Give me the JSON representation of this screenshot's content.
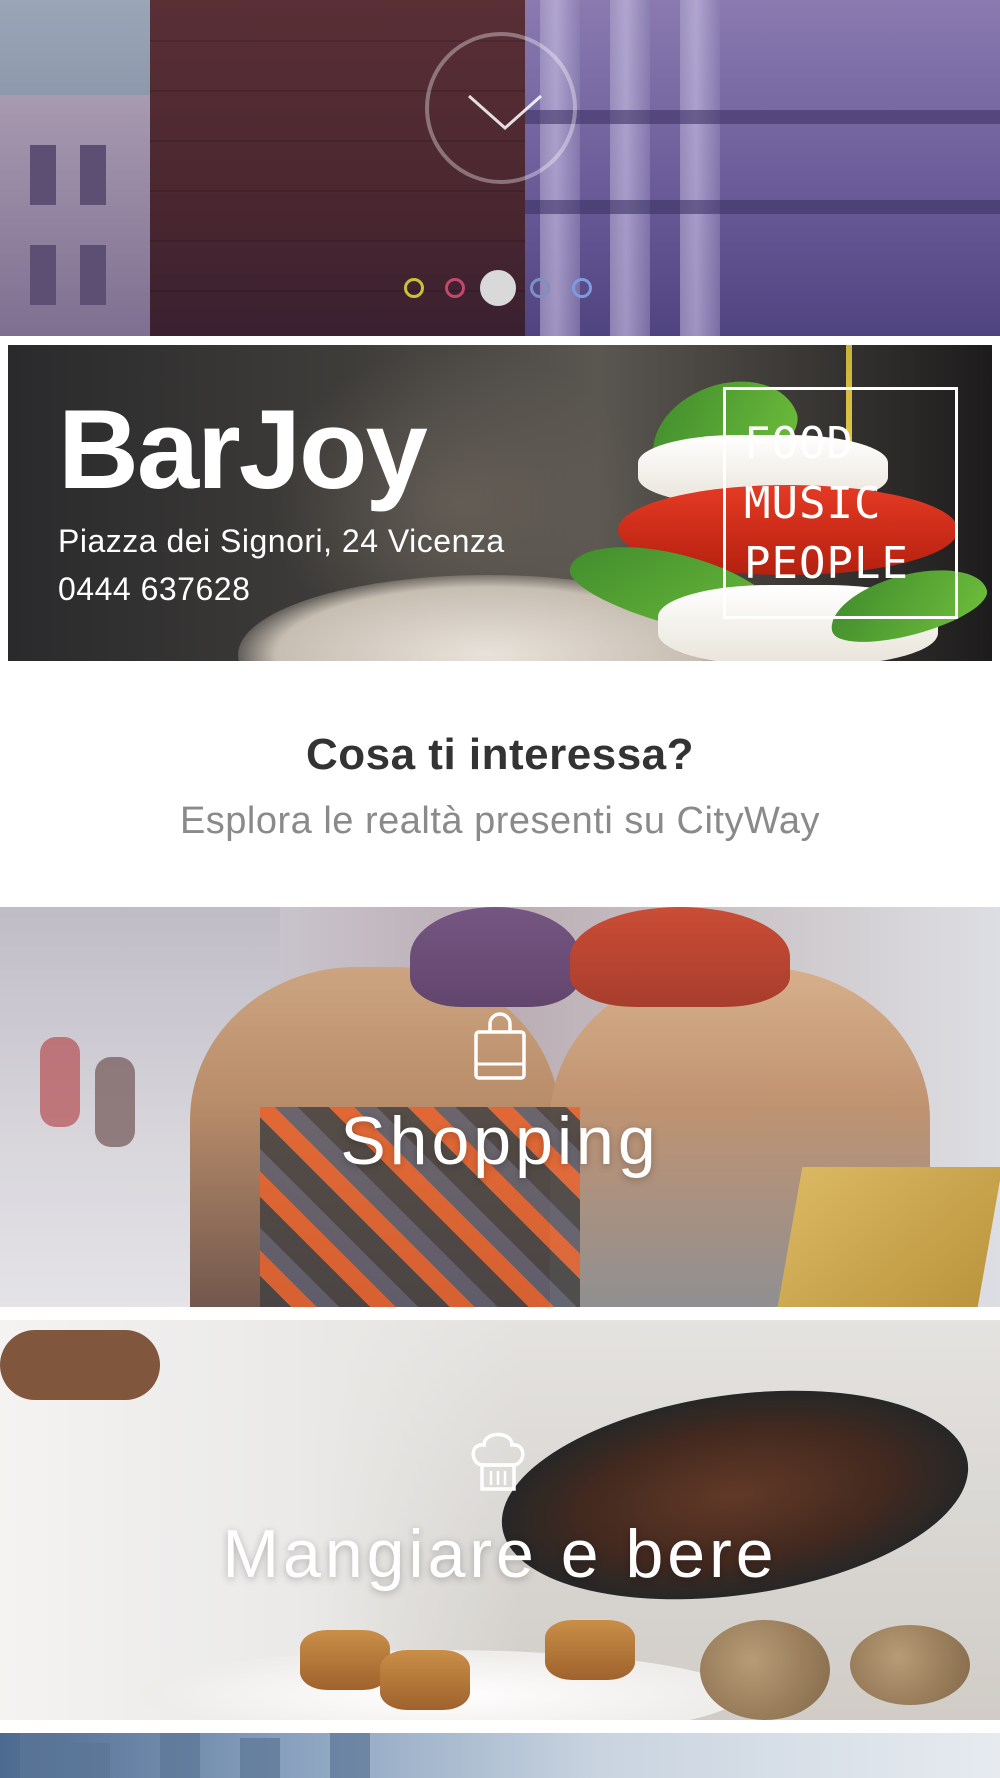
{
  "hero": {
    "scroll_icon": "chevron-down-icon",
    "dots": [
      {
        "color": "#c9c236",
        "active": false
      },
      {
        "color": "#c4476c",
        "active": false
      },
      {
        "color": "#d9d9d9",
        "active": true
      },
      {
        "color": "#7f90c0",
        "active": false
      },
      {
        "color": "#7f9be0",
        "active": false
      }
    ]
  },
  "promo": {
    "name": "BarJoy",
    "address": "Piazza dei Signori, 24 Vicenza",
    "phone": "0444 637628",
    "tagline": [
      "FOOD",
      "MUSIC",
      "PEOPLE"
    ]
  },
  "intro": {
    "title": "Cosa ti interessa?",
    "subtitle": "Esplora le realtà presenti su CityWay"
  },
  "categories": [
    {
      "label": "Shopping",
      "icon": "shopping-bag-icon"
    },
    {
      "label": "Mangiare e bere",
      "icon": "chef-hat-icon"
    }
  ]
}
